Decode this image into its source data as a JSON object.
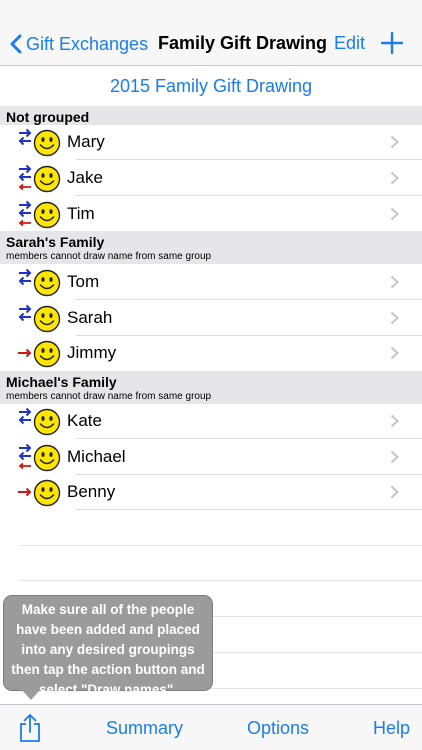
{
  "nav": {
    "back_label": "Gift Exchanges",
    "title": "Family Gift Drawing",
    "edit_label": "Edit"
  },
  "exchange_title": "2015 Family Gift Drawing",
  "groups": [
    {
      "title": "Not grouped",
      "subtitle": "",
      "members": [
        {
          "name": "Mary",
          "gives": true,
          "receives": false
        },
        {
          "name": "Jake",
          "gives": true,
          "receives": true
        },
        {
          "name": "Tim",
          "gives": true,
          "receives": true
        }
      ]
    },
    {
      "title": "Sarah's Family",
      "subtitle": "members cannot draw name from same group",
      "members": [
        {
          "name": "Tom",
          "gives": true,
          "receives": false
        },
        {
          "name": "Sarah",
          "gives": true,
          "receives": false
        },
        {
          "name": "Jimmy",
          "gives": false,
          "receives": true
        }
      ]
    },
    {
      "title": "Michael's Family",
      "subtitle": "members cannot draw name from same group",
      "members": [
        {
          "name": "Kate",
          "gives": true,
          "receives": false
        },
        {
          "name": "Michael",
          "gives": true,
          "receives": true
        },
        {
          "name": "Benny",
          "gives": false,
          "receives": true
        }
      ]
    }
  ],
  "tooltip": "Make sure all of the people have been added and placed into any desired groupings then tap the action button and select \"Draw names\".",
  "toolbar": {
    "summary_label": "Summary",
    "options_label": "Options",
    "help_label": "Help"
  },
  "colors": {
    "accent": "#1a7cf5",
    "give_arrow": "#1f33c9",
    "receive_arrow": "#cc1a1a",
    "smiley": "#ffe600"
  }
}
